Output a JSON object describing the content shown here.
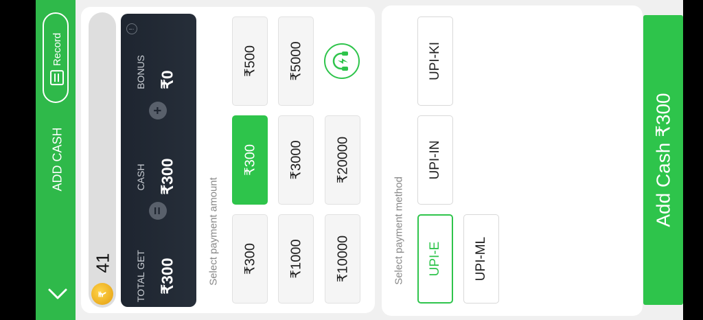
{
  "header": {
    "title": "ADD CASH",
    "record_label": "Record"
  },
  "balance": {
    "coins": "41",
    "coin_symbol": "₹"
  },
  "summary": {
    "info": "!",
    "total_label": "TOTAL GET",
    "total_value": "₹300",
    "equals": "=",
    "cash_label": "CASH",
    "cash_value": "₹300",
    "plus": "+",
    "bonus_label": "BONUS",
    "bonus_value": "₹0"
  },
  "amount_section": {
    "label": "Select payment amount",
    "options": [
      "₹300",
      "₹1000",
      "₹10000",
      "₹300",
      "₹3000",
      "₹20000",
      "₹500",
      "₹5000"
    ],
    "selected_index": 3
  },
  "method_section": {
    "label": "Select payment method",
    "options": [
      "UPI-E",
      "UPI-ML",
      "UPI-IN",
      "UPI-KI"
    ],
    "selected_index": 0
  },
  "add_cash_button": "Add Cash ₹300",
  "icons": {
    "back": "chevron-down-icon",
    "record": "record-list-icon",
    "support": "headset-support-icon",
    "coin": "coin-icon"
  },
  "colors": {
    "brand_green": "#2fb94a",
    "accent_green": "#2ec44b",
    "card_dark": "#1e2530"
  }
}
